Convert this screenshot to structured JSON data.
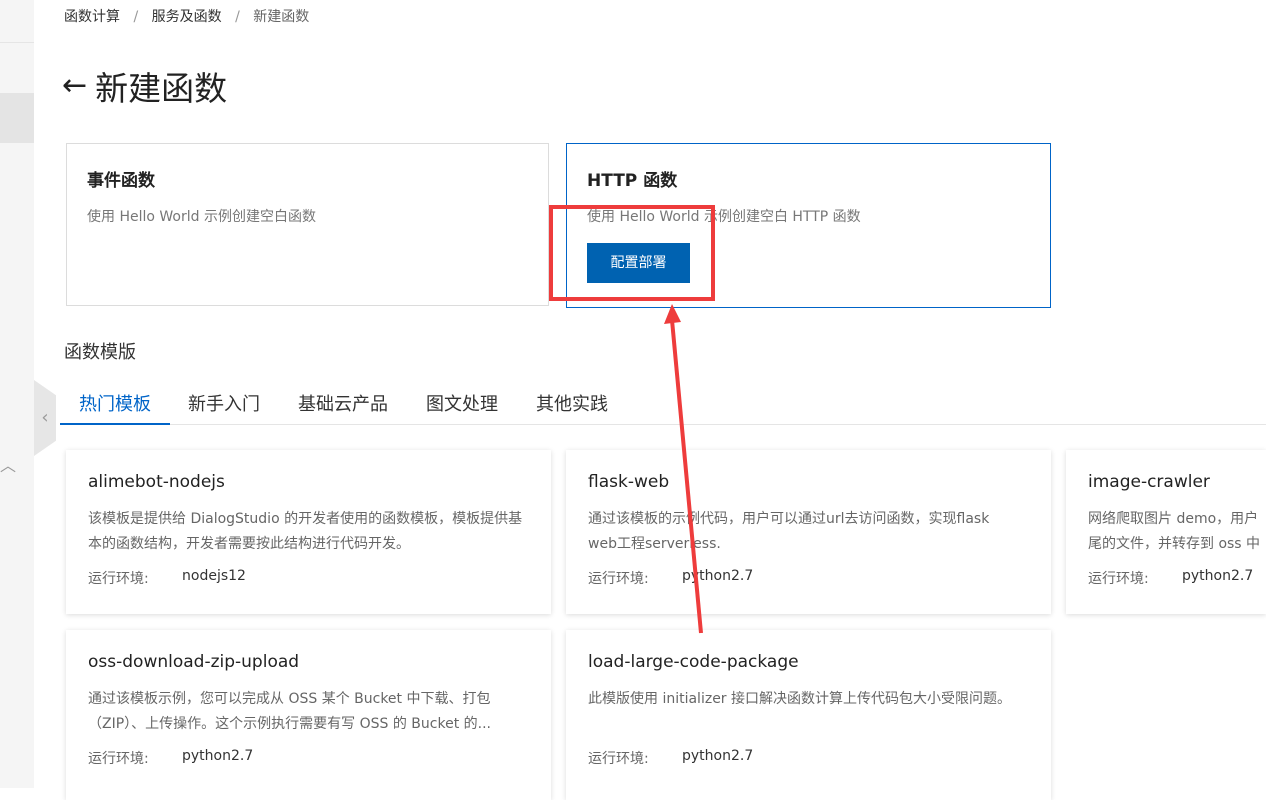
{
  "breadcrumb": {
    "items": [
      "函数计算",
      "服务及函数"
    ],
    "current": "新建函数",
    "separator": "/"
  },
  "page": {
    "title": "新建函数",
    "back_arrow": "←"
  },
  "function_types": [
    {
      "title": "事件函数",
      "desc": "使用 Hello World 示例创建空白函数"
    },
    {
      "title": "HTTP 函数",
      "desc": "使用 Hello World 示例创建空白 HTTP 函数",
      "button": "配置部署"
    }
  ],
  "templates": {
    "section_title": "函数模版",
    "tabs": [
      "热门模板",
      "新手入门",
      "基础云产品",
      "图文处理",
      "其他实践"
    ],
    "active_tab": "热门模板",
    "env_label": "运行环境:",
    "cards": [
      {
        "name": "alimebot-nodejs",
        "desc": "该模板是提供给 DialogStudio 的开发者使用的函数模板，模板提供基本的函数结构，开发者需要按此结构进行代码开发。",
        "env": "nodejs12"
      },
      {
        "name": "flask-web",
        "desc": "通过该模板的示例代码，用户可以通过url去访问函数，实现flask web工程serverless.",
        "env": "python2.7"
      },
      {
        "name": "image-crawler",
        "desc": "网络爬取图片 demo，用户\n尾的文件，并转存到 oss 中",
        "env": "python2.7"
      },
      {
        "name": "oss-download-zip-upload",
        "desc": "通过该模板示例，您可以完成从 OSS 某个 Bucket 中下载、打包（ZIP）、上传操作。这个示例执行需要有写 OSS 的 Bucket 的...",
        "env": "python2.7"
      },
      {
        "name": "load-large-code-package",
        "desc": "此模版使用 initializer 接口解决函数计算上传代码包大小受限问题。",
        "env": "python2.7"
      }
    ]
  },
  "colors": {
    "primary": "#0064c8",
    "button": "#0062b1",
    "annotation": "#ee3c3c"
  },
  "icons": {
    "left_collapse": "chevron-left-icon",
    "sidebar_up": "chevron-up-icon"
  }
}
